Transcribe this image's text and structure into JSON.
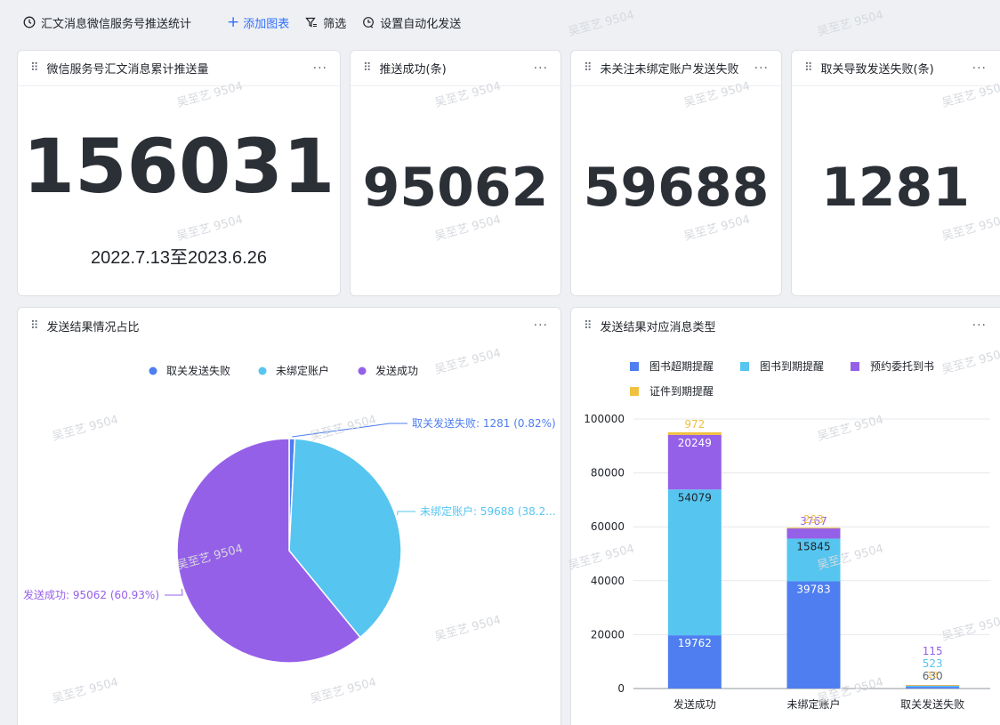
{
  "toolbar": {
    "title": "汇文消息微信服务号推送统计",
    "add_chart": "添加图表",
    "filter": "筛选",
    "auto_send": "设置自动化发送"
  },
  "cards": {
    "total": {
      "title": "微信服务号汇文消息累计推送量",
      "value": "156031",
      "subtitle": "2022.7.13至2023.6.26"
    },
    "success": {
      "title": "推送成功(条)",
      "value": "95062"
    },
    "unbound": {
      "title": "未关注未绑定账户发送失败",
      "value": "59688"
    },
    "unfollow": {
      "title": "取关导致发送失败(条)",
      "value": "1281"
    },
    "pie": {
      "title": "发送结果情况占比"
    },
    "stack": {
      "title": "发送结果对应消息类型"
    }
  },
  "more_label": "···",
  "watermark": "吴至艺 9504",
  "pie_chart": {
    "type": "pie",
    "legend": [
      "取关发送失败",
      "未绑定账户",
      "发送成功"
    ],
    "slices": [
      {
        "name": "取关发送失败",
        "value": 1281,
        "label": "取关发送失败: 1281 (0.82%)",
        "color": "#4e7ef0"
      },
      {
        "name": "未绑定账户",
        "value": 59688,
        "label": "未绑定账户: 59688 (38.2...",
        "color": "#56c5f0"
      },
      {
        "name": "发送成功",
        "value": 95062,
        "label": "发送成功: 95062 (60.93%)",
        "color": "#9560e8"
      }
    ]
  },
  "chart_data": {
    "type": "bar",
    "stacked": true,
    "categories": [
      "发送成功",
      "未绑定账户",
      "取关发送失败"
    ],
    "series": [
      {
        "name": "图书超期提醒",
        "values": [
          19762,
          39783,
          630
        ],
        "color": "#4e7ef0"
      },
      {
        "name": "图书到期提醒",
        "values": [
          54079,
          15845,
          523
        ],
        "color": "#56c5f0"
      },
      {
        "name": "预约委托到书",
        "values": [
          20249,
          3767,
          115
        ],
        "color": "#9560e8"
      },
      {
        "name": "证件到期提醒",
        "values": [
          972,
          293,
          13
        ],
        "color": "#f0c040"
      }
    ],
    "ylim": [
      0,
      100000
    ],
    "yticks": [
      "0",
      "20000",
      "40000",
      "60000",
      "80000",
      "100000"
    ],
    "grid": true,
    "legend_position": "top-left"
  }
}
